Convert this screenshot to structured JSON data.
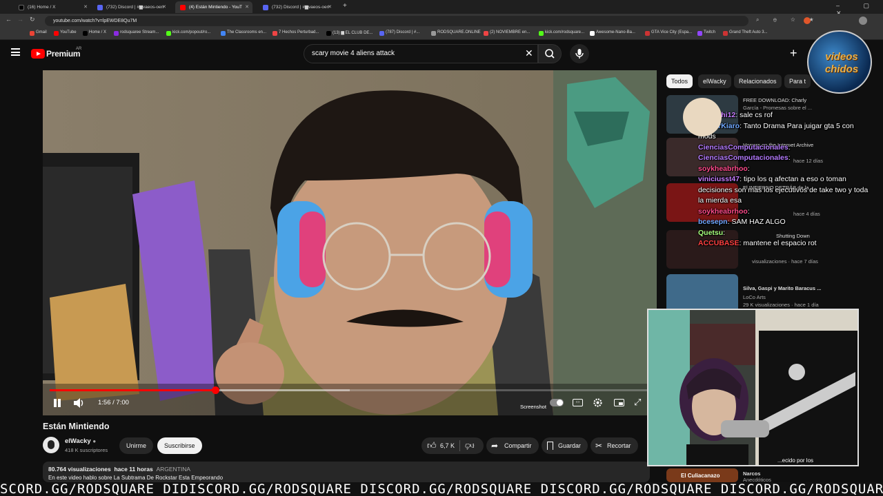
{
  "browser": {
    "tabs": [
      {
        "label": "(16) Home / X",
        "color": "#000000"
      },
      {
        "label": "(732) Discord | #▆vaeos-oen",
        "color": "#5865f2"
      },
      {
        "label": "(4) Están Mintiendo - YouT",
        "color": "#ff0000"
      },
      {
        "label": "(732) Discord | #▆vaeos-oen",
        "color": "#5865f2"
      }
    ],
    "url": "youtube.com/watch?v=lpEWDE8Qu7M",
    "bookmarks": [
      "Gmail",
      "YouTube",
      "Home / X",
      "rodsquaree Stream...",
      "kick.com/popout/ro...",
      "The Classrooms en...",
      "7 Hechos Perturbad...",
      "(13) ▆ EL CLUB DE...",
      "(787) Discord | #...",
      "RODSQUARE.ONLINE",
      "(2) NOVIEMBRE en...",
      "kick.com/rodsquare...",
      "Awesome-Nano-Ba...",
      "GTA Vice City (Espa...",
      "Twitch",
      "Grand Theft Auto 3..."
    ]
  },
  "youtube": {
    "logo_text": "Premium",
    "region": "AR",
    "search_value": "scary movie 4 aliens attack",
    "chips": [
      "Todos",
      "elWacky",
      "Relacionados",
      "Para t"
    ]
  },
  "player": {
    "time": "1:56 / 7:00",
    "progress": 0.276,
    "buffered": 0.5,
    "screenshot_label": "Screenshot"
  },
  "video": {
    "title": "Están Mintiendo",
    "channel": "elWacky",
    "subscribers": "418 K suscriptores",
    "join_label": "Unirme",
    "subscribe_label": "Suscribirse",
    "likes": "6,7 K",
    "share_label": "Compartir",
    "save_label": "Guardar",
    "clip_label": "Recortar",
    "views": "80.764 visualizaciones",
    "age": "hace 11 horas",
    "country": "ARGENTINA",
    "description": "En este video hablo sobre La Subtrama De Rockstar Esta Empeorando"
  },
  "recommendations": [
    {
      "title": "FREE DOWNLOAD: Charly",
      "sub": "García - Promesas sobre el ..."
    },
    {
      "title": "Horrors on the Internet Archive",
      "sub": "hace 12 días"
    },
    {
      "title": "El INFIERNO DETRÁS de la",
      "sub": "hace 4 días"
    },
    {
      "title": "Shutting Down",
      "sub": "visualizaciones · hace 7 días"
    },
    {
      "title": "Silva, Gaspi y Marito Baracus ...",
      "sub": "LoCo Arts"
    },
    {
      "title": "29 K visualizaciones · hace 1 día",
      "sub": ""
    },
    {
      "title": "...ecido por los",
      "sub": ""
    },
    {
      "title": "Narcos",
      "sub": "Anecdóticos"
    }
  ],
  "chat": [
    {
      "name": "Mariachi12",
      "text": "sale cs rof",
      "color": "#c77dff"
    },
    {
      "name": "GamerKiaro",
      "text": "Tanto Drama Para juigar gta 5 con mods",
      "color": "#6fa8ff"
    },
    {
      "name": "CienciasComputacionales",
      "text": "",
      "color": "#b57bff"
    },
    {
      "name": "CienciasComputacionales",
      "text": "",
      "color": "#b57bff"
    },
    {
      "name": "soykheabrhoo",
      "text": "",
      "color": "#ff4b8b"
    },
    {
      "name": "viniciusst47",
      "text": "tipo los q afectan a eso o toman decisiones son mas los ejecutivos de take two y toda la mierda esa",
      "color": "#c77dff"
    },
    {
      "name": "soykheabrhoo",
      "text": "",
      "color": "#ff4b8b"
    },
    {
      "name": "bcesepn",
      "text": "SAM HAZ ALGO",
      "color": "#6fa8ff"
    },
    {
      "name": "Quetsu",
      "text": "",
      "color": "#a7ff7d"
    },
    {
      "name": "ACCUBASE",
      "text": "mantene el espacio rot",
      "color": "#ff4040"
    }
  ],
  "overlay": {
    "logo_line1": "videos",
    "logo_line2": "chidos"
  },
  "ticker": "SCORD.GG/RODSQUARE DIDISCORD.GG/RODSQUARE DISCORD.GG/RODSQUARE DISCORD.GG/RODSQUARE DISCORD.GG/RODSQUARE"
}
